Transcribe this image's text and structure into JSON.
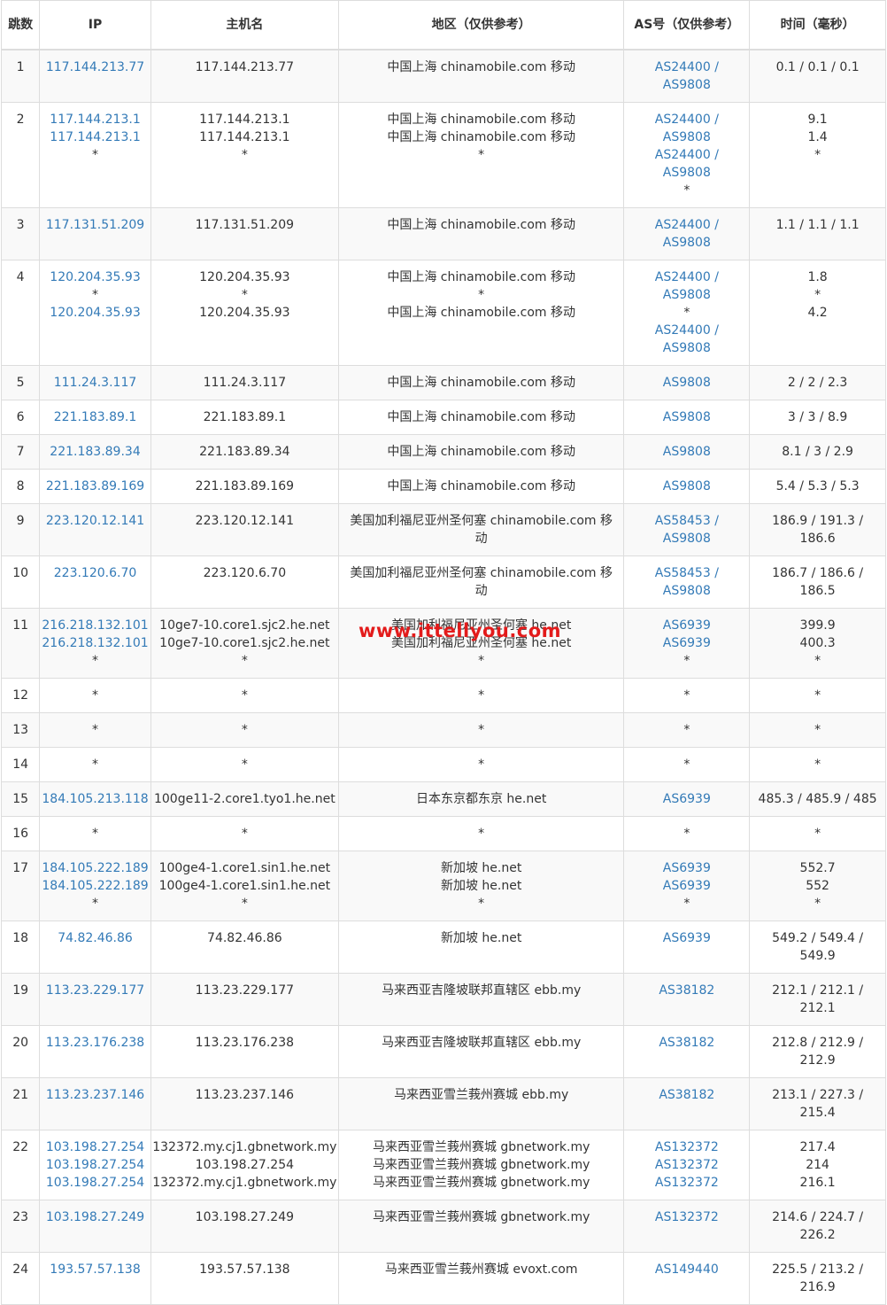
{
  "columns": [
    "跳数",
    "IP",
    "主机名",
    "地区（仅供参考）",
    "AS号（仅供参考）",
    "时间（毫秒）"
  ],
  "watermark": "www.ittellyou.com",
  "rows": [
    {
      "hop": "1",
      "ip": [
        "117.144.213.77"
      ],
      "host": [
        "117.144.213.77"
      ],
      "region": [
        "中国上海 chinamobile.com 移动"
      ],
      "as": [
        "AS24400 /",
        "AS9808"
      ],
      "time": [
        "0.1 / 0.1 / 0.1"
      ]
    },
    {
      "hop": "2",
      "ip": [
        "117.144.213.1",
        "117.144.213.1",
        "*"
      ],
      "host": [
        "117.144.213.1",
        "117.144.213.1",
        "*"
      ],
      "region": [
        "中国上海 chinamobile.com 移动",
        "中国上海 chinamobile.com 移动",
        "*"
      ],
      "as": [
        "AS24400 /",
        "AS9808",
        "AS24400 /",
        "AS9808",
        "*"
      ],
      "time": [
        "9.1",
        "1.4",
        "*"
      ]
    },
    {
      "hop": "3",
      "ip": [
        "117.131.51.209"
      ],
      "host": [
        "117.131.51.209"
      ],
      "region": [
        "中国上海 chinamobile.com 移动"
      ],
      "as": [
        "AS24400 /",
        "AS9808"
      ],
      "time": [
        "1.1 / 1.1 / 1.1"
      ]
    },
    {
      "hop": "4",
      "ip": [
        "120.204.35.93",
        "*",
        "120.204.35.93"
      ],
      "host": [
        "120.204.35.93",
        "*",
        "120.204.35.93"
      ],
      "region": [
        "中国上海 chinamobile.com 移动",
        "*",
        "中国上海 chinamobile.com 移动"
      ],
      "as": [
        "AS24400 /",
        "AS9808",
        "*",
        "AS24400 /",
        "AS9808"
      ],
      "time": [
        "1.8",
        "*",
        "4.2"
      ]
    },
    {
      "hop": "5",
      "ip": [
        "111.24.3.117"
      ],
      "host": [
        "111.24.3.117"
      ],
      "region": [
        "中国上海 chinamobile.com 移动"
      ],
      "as": [
        "AS9808"
      ],
      "time": [
        "2 / 2 / 2.3"
      ]
    },
    {
      "hop": "6",
      "ip": [
        "221.183.89.1"
      ],
      "host": [
        "221.183.89.1"
      ],
      "region": [
        "中国上海 chinamobile.com 移动"
      ],
      "as": [
        "AS9808"
      ],
      "time": [
        "3 / 3 / 8.9"
      ]
    },
    {
      "hop": "7",
      "ip": [
        "221.183.89.34"
      ],
      "host": [
        "221.183.89.34"
      ],
      "region": [
        "中国上海 chinamobile.com 移动"
      ],
      "as": [
        "AS9808"
      ],
      "time": [
        "8.1 / 3 / 2.9"
      ]
    },
    {
      "hop": "8",
      "ip": [
        "221.183.89.169"
      ],
      "host": [
        "221.183.89.169"
      ],
      "region": [
        "中国上海 chinamobile.com 移动"
      ],
      "as": [
        "AS9808"
      ],
      "time": [
        "5.4 / 5.3 / 5.3"
      ]
    },
    {
      "hop": "9",
      "ip": [
        "223.120.12.141"
      ],
      "host": [
        "223.120.12.141"
      ],
      "region": [
        "美国加利福尼亚州圣何塞 chinamobile.com 移动"
      ],
      "as": [
        "AS58453 /",
        "AS9808"
      ],
      "time": [
        "186.9 / 191.3 /",
        "186.6"
      ]
    },
    {
      "hop": "10",
      "ip": [
        "223.120.6.70"
      ],
      "host": [
        "223.120.6.70"
      ],
      "region": [
        "美国加利福尼亚州圣何塞 chinamobile.com 移动"
      ],
      "as": [
        "AS58453 /",
        "AS9808"
      ],
      "time": [
        "186.7 / 186.6 /",
        "186.5"
      ]
    },
    {
      "hop": "11",
      "ip": [
        "216.218.132.101",
        "216.218.132.101",
        "*"
      ],
      "host": [
        "10ge7-10.core1.sjc2.he.net",
        "10ge7-10.core1.sjc2.he.net",
        "*"
      ],
      "region": [
        "美国加利福尼亚州圣何塞 he.net",
        "美国加利福尼亚州圣何塞 he.net",
        "*"
      ],
      "as": [
        "AS6939",
        "AS6939",
        "*"
      ],
      "time": [
        "399.9",
        "400.3",
        "*"
      ]
    },
    {
      "hop": "12",
      "ip": [
        "*"
      ],
      "host": [
        "*"
      ],
      "region": [
        "*"
      ],
      "as": [
        "*"
      ],
      "time": [
        "*"
      ]
    },
    {
      "hop": "13",
      "ip": [
        "*"
      ],
      "host": [
        "*"
      ],
      "region": [
        "*"
      ],
      "as": [
        "*"
      ],
      "time": [
        "*"
      ]
    },
    {
      "hop": "14",
      "ip": [
        "*"
      ],
      "host": [
        "*"
      ],
      "region": [
        "*"
      ],
      "as": [
        "*"
      ],
      "time": [
        "*"
      ]
    },
    {
      "hop": "15",
      "ip": [
        "184.105.213.118"
      ],
      "host": [
        "100ge11-2.core1.tyo1.he.net"
      ],
      "region": [
        "日本东京都东京 he.net"
      ],
      "as": [
        "AS6939"
      ],
      "time": [
        "485.3 / 485.9 / 485"
      ]
    },
    {
      "hop": "16",
      "ip": [
        "*"
      ],
      "host": [
        "*"
      ],
      "region": [
        "*"
      ],
      "as": [
        "*"
      ],
      "time": [
        "*"
      ]
    },
    {
      "hop": "17",
      "ip": [
        "184.105.222.189",
        "184.105.222.189",
        "*"
      ],
      "host": [
        "100ge4-1.core1.sin1.he.net",
        "100ge4-1.core1.sin1.he.net",
        "*"
      ],
      "region": [
        "新加坡 he.net",
        "新加坡 he.net",
        "*"
      ],
      "as": [
        "AS6939",
        "AS6939",
        "*"
      ],
      "time": [
        "552.7",
        "552",
        "*"
      ]
    },
    {
      "hop": "18",
      "ip": [
        "74.82.46.86"
      ],
      "host": [
        "74.82.46.86"
      ],
      "region": [
        "新加坡 he.net"
      ],
      "as": [
        "AS6939"
      ],
      "time": [
        "549.2 / 549.4 /",
        "549.9"
      ]
    },
    {
      "hop": "19",
      "ip": [
        "113.23.229.177"
      ],
      "host": [
        "113.23.229.177"
      ],
      "region": [
        "马来西亚吉隆坡联邦直辖区 ebb.my"
      ],
      "as": [
        "AS38182"
      ],
      "time": [
        "212.1 / 212.1 /",
        "212.1"
      ]
    },
    {
      "hop": "20",
      "ip": [
        "113.23.176.238"
      ],
      "host": [
        "113.23.176.238"
      ],
      "region": [
        "马来西亚吉隆坡联邦直辖区 ebb.my"
      ],
      "as": [
        "AS38182"
      ],
      "time": [
        "212.8 / 212.9 /",
        "212.9"
      ]
    },
    {
      "hop": "21",
      "ip": [
        "113.23.237.146"
      ],
      "host": [
        "113.23.237.146"
      ],
      "region": [
        "马来西亚雪兰莪州赛城 ebb.my"
      ],
      "as": [
        "AS38182"
      ],
      "time": [
        "213.1 / 227.3 /",
        "215.4"
      ]
    },
    {
      "hop": "22",
      "ip": [
        "103.198.27.254",
        "103.198.27.254",
        "103.198.27.254"
      ],
      "host": [
        "132372.my.cj1.gbnetwork.my",
        "103.198.27.254",
        "132372.my.cj1.gbnetwork.my"
      ],
      "region": [
        "马来西亚雪兰莪州赛城 gbnetwork.my",
        "马来西亚雪兰莪州赛城 gbnetwork.my",
        "马来西亚雪兰莪州赛城 gbnetwork.my"
      ],
      "as": [
        "AS132372",
        "AS132372",
        "AS132372"
      ],
      "time": [
        "217.4",
        "214",
        "216.1"
      ]
    },
    {
      "hop": "23",
      "ip": [
        "103.198.27.249"
      ],
      "host": [
        "103.198.27.249"
      ],
      "region": [
        "马来西亚雪兰莪州赛城 gbnetwork.my"
      ],
      "as": [
        "AS132372"
      ],
      "time": [
        "214.6 / 224.7 /",
        "226.2"
      ]
    },
    {
      "hop": "24",
      "ip": [
        "193.57.57.138"
      ],
      "host": [
        "193.57.57.138"
      ],
      "region": [
        "马来西亚雪兰莪州赛城 evoxt.com"
      ],
      "as": [
        "AS149440"
      ],
      "time": [
        "225.5 / 213.2 /",
        "216.9"
      ]
    }
  ]
}
